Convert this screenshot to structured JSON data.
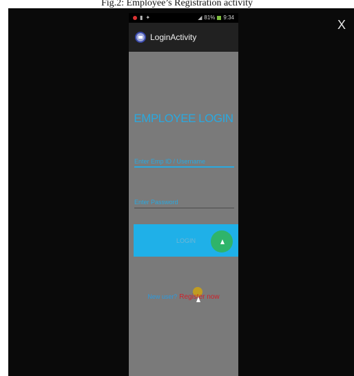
{
  "caption": "Fig.2:  Employee’s Registration activity",
  "overlay": {
    "close_label": "X"
  },
  "status_bar": {
    "signal_text": "81%",
    "time": "9:34"
  },
  "action_bar": {
    "title": "LoginActivity"
  },
  "login": {
    "heading": "EMPLOYEE LOGIN",
    "username_placeholder": "Enter Emp ID / Username",
    "password_placeholder": "Enter Password",
    "login_label": "LOGIN",
    "register_prompt": "New user?",
    "register_link": "Register now"
  },
  "colors": {
    "accent": "#29a9e0",
    "button": "#1fb0e8",
    "link": "#d0202a",
    "background": "#7a7a7a"
  },
  "icons": [
    "close-icon",
    "notification-icon",
    "usb-icon",
    "android-icon",
    "signal-icon",
    "battery-icon",
    "app-icon",
    "cursor-icon"
  ]
}
